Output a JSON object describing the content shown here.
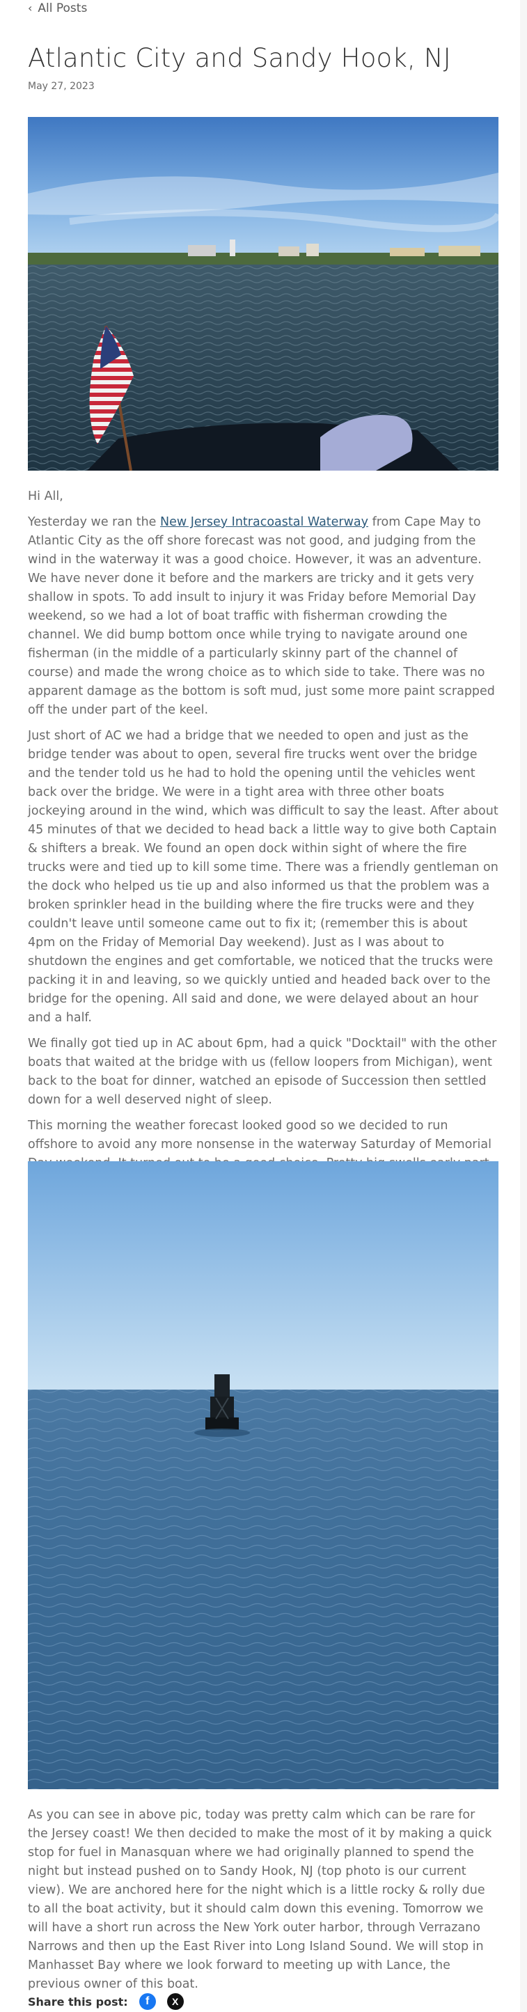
{
  "nav": {
    "back_label": "All Posts"
  },
  "post": {
    "title": "Atlantic City and Sandy Hook, NJ",
    "date": "May 27, 2023",
    "greeting": "Hi All,",
    "p1_before": "Yesterday we ran the ",
    "p1_link": "New Jersey Intracoastal Waterway",
    "p1_after": " from Cape May to Atlantic City as the off shore forecast was not good, and judging from the wind in the waterway it was a good choice. However, it was an adventure. We have never done it before and the markers are tricky and it gets very shallow in spots. To add insult to injury it was Friday before Memorial Day weekend, so we had a lot of boat traffic with fisherman crowding the channel. We did bump bottom once while trying to navigate around one fisherman (in the middle of a particularly skinny part of the channel of course) and made the wrong choice as to which side to take. There was no apparent damage as the bottom is soft mud, just some more paint scrapped off the under part of the keel.",
    "p2": "Just short of AC we had a bridge that we needed to open and just as the bridge tender was about to open, several fire trucks went over the bridge and the tender told us he had to hold the opening until the vehicles went back over the bridge. We were in a tight area with three other boats jockeying around in the wind, which was difficult to say the least. After about 45 minutes of that we decided to head back a little way to give both Captain & shifters a break.  We found an open dock within sight of where the fire trucks were and tied up to kill some time. There was a friendly gentleman on the dock who helped us tie up and also informed us that the problem was a broken sprinkler head in the building where the fire trucks were and they couldn't leave until someone came out to fix it; (remember this is about 4pm on the Friday of Memorial Day weekend). Just as I was about to shutdown the engines and get comfortable, we noticed that the trucks were packing it in and leaving, so we quickly untied and headed back over to the bridge for the opening. All said and done, we were delayed about an hour and a half.",
    "p3": "We finally got tied up in AC about 6pm, had a quick \"Docktail\" with the other boats that waited at the bridge with us (fellow loopers from Michigan), went back to the boat for dinner, watched an episode of Succession then settled down for a well deserved night of sleep.",
    "p4": "This morning the weather forecast looked good so we decided to run offshore to avoid any more nonsense in the waterway Saturday of Memorial Day weekend. It turned out to be a good choice. Pretty big swells early part of the trip but this boat rides them well!",
    "p5": "As you can see in above pic, today was pretty calm which can be rare for the Jersey coast! We then decided to make the most of it by making a quick stop for fuel in Manasquan where we had originally planned to spend the night but instead pushed on to Sandy Hook, NJ  (top photo is our current view). We are anchored here for the night which is a little rocky & rolly due to all the boat activity, but it should calm down this evening. Tomorrow we will have a short run across the New York outer harbor, through Verrazano Narrows and then up the East River into Long Island Sound. We will stop in Manhasset Bay where we look forward to meeting up with Lance, the previous owner of this boat."
  },
  "share": {
    "label": "Share this post:",
    "facebook_glyph": "f",
    "x_glyph": "X"
  },
  "icons": {
    "back": "chevron-left-icon",
    "facebook": "facebook-icon",
    "x": "x-twitter-icon"
  },
  "colors": {
    "link": "#2d5a7b",
    "facebook": "#1877f2",
    "x": "#111111"
  }
}
